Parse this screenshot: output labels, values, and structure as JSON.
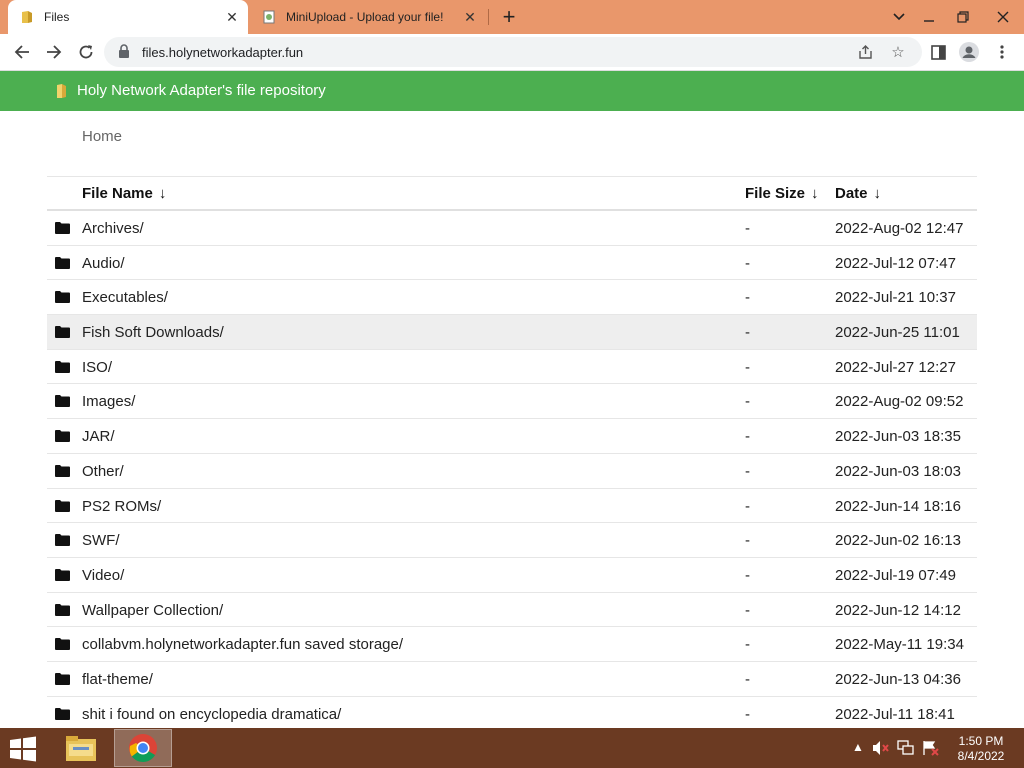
{
  "browser": {
    "tabs": [
      {
        "title": "Files",
        "active": true
      },
      {
        "title": "MiniUpload - Upload your file!",
        "active": false
      }
    ],
    "url": "files.holynetworkadapter.fun"
  },
  "header": {
    "title": "Holy Network Adapter's file repository",
    "color": "#4caf50"
  },
  "breadcrumb": "Home",
  "table": {
    "columns": [
      {
        "label": "File Name",
        "sort": "↓"
      },
      {
        "label": "File Size",
        "sort": "↓"
      },
      {
        "label": "Date",
        "sort": "↓"
      }
    ],
    "rows": [
      {
        "name": "Archives/",
        "size": "-",
        "date": "2022-Aug-02 12:47"
      },
      {
        "name": "Audio/",
        "size": "-",
        "date": "2022-Jul-12 07:47"
      },
      {
        "name": "Executables/",
        "size": "-",
        "date": "2022-Jul-21 10:37"
      },
      {
        "name": "Fish Soft Downloads/",
        "size": "-",
        "date": "2022-Jun-25 11:01"
      },
      {
        "name": "ISO/",
        "size": "-",
        "date": "2022-Jul-27 12:27"
      },
      {
        "name": "Images/",
        "size": "-",
        "date": "2022-Aug-02 09:52"
      },
      {
        "name": "JAR/",
        "size": "-",
        "date": "2022-Jun-03 18:35"
      },
      {
        "name": "Other/",
        "size": "-",
        "date": "2022-Jun-03 18:03"
      },
      {
        "name": "PS2 ROMs/",
        "size": "-",
        "date": "2022-Jun-14 18:16"
      },
      {
        "name": "SWF/",
        "size": "-",
        "date": "2022-Jun-02 16:13"
      },
      {
        "name": "Video/",
        "size": "-",
        "date": "2022-Jul-19 07:49"
      },
      {
        "name": "Wallpaper Collection/",
        "size": "-",
        "date": "2022-Jun-12 14:12"
      },
      {
        "name": "collabvm.holynetworkadapter.fun saved storage/",
        "size": "-",
        "date": "2022-May-11 19:34"
      },
      {
        "name": "flat-theme/",
        "size": "-",
        "date": "2022-Jun-13 04:36"
      },
      {
        "name": "shit i found on encyclopedia dramatica/",
        "size": "-",
        "date": "2022-Jul-11 18:41"
      }
    ]
  },
  "taskbar": {
    "time": "1:50 PM",
    "date": "8/4/2022",
    "apps": [
      "file-explorer",
      "chrome"
    ]
  }
}
